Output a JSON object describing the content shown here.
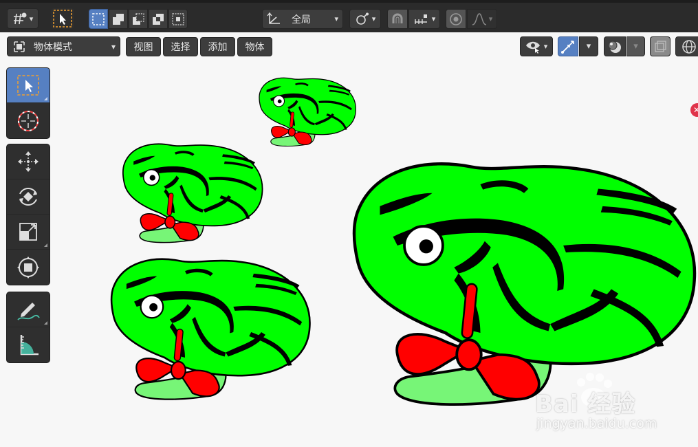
{
  "header": {
    "pivot_icon": "pivot-point-icon",
    "select_tool_icon": "cursor-select-icon",
    "select_modes": [
      "select-new-icon",
      "select-extend-icon",
      "select-subtract-icon",
      "select-difference-icon",
      "select-intersect-icon"
    ],
    "transform_orientation": {
      "label": "全局",
      "icon": "transform-orientation-icon"
    },
    "snap_icon": "snap-link-icon",
    "snapping_icon": "magnet-snap-icon",
    "snap_target_icon": "snap-increment-icon",
    "proportional_edit_icon": "proportional-edit-icon",
    "falloff_icon": "falloff-curve-icon"
  },
  "subheader": {
    "mode_label": "物体模式",
    "menus": [
      "视图",
      "选择",
      "添加",
      "物体"
    ],
    "visibility_icon": "eye-visibility-icon",
    "gizmo_icon": "gizmo-icon",
    "overlay_icon": "overlay-icon",
    "xray_icon": "xray-icon",
    "shading_icon": "viewport-shading-icon"
  },
  "toolbar": {
    "tools": [
      {
        "name": "tool-select-box",
        "icon": "select-box-icon",
        "active": true
      },
      {
        "name": "tool-cursor",
        "icon": "3d-cursor-icon",
        "active": false
      },
      {
        "name": "tool-move",
        "icon": "move-arrows-icon",
        "active": false
      },
      {
        "name": "tool-rotate",
        "icon": "rotate-icon",
        "active": false
      },
      {
        "name": "tool-scale",
        "icon": "scale-icon",
        "active": false
      },
      {
        "name": "tool-transform",
        "icon": "transform-icon",
        "active": false
      },
      {
        "name": "tool-annotate",
        "icon": "annotate-pencil-icon",
        "active": false
      },
      {
        "name": "tool-measure",
        "icon": "measure-ruler-icon",
        "active": false
      }
    ]
  },
  "viewport": {
    "objects": [
      "frog-small-top",
      "frog-middle-left",
      "frog-bottom-left",
      "frog-large-right"
    ],
    "body_color": "#00ff00",
    "stripe_color": "#000000",
    "bow_color": "#ff0000",
    "tail_color": "#77f577"
  },
  "watermark": {
    "main": "Bai 经验",
    "sub": "jingyan.baidu.com"
  },
  "colors": {
    "header_bg": "#2b2b2b",
    "button_bg": "#3d3d3d",
    "accent": "#5680c2",
    "viewport_bg": "#f7f7f7"
  }
}
